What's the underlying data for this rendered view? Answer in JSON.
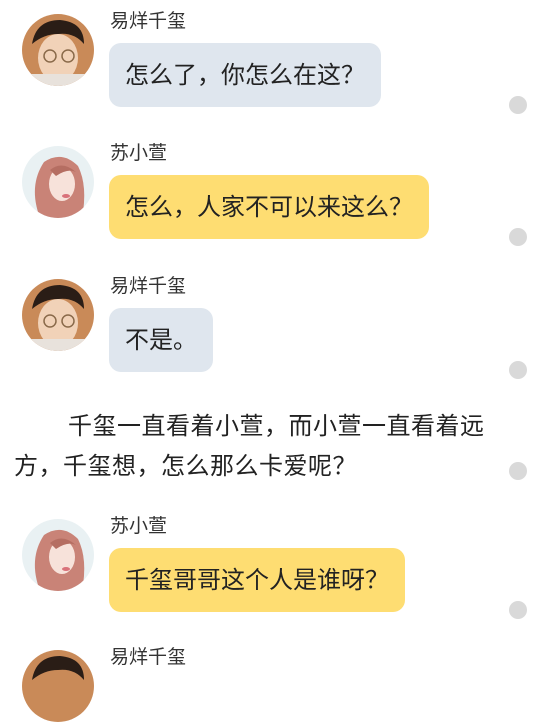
{
  "messages": [
    {
      "speaker": "易烊千玺",
      "avatar": "male-avatar",
      "bubble_color": "#dfe6ee",
      "text": "怎么了，你怎么在这？"
    },
    {
      "speaker": "苏小萱",
      "avatar": "female-avatar",
      "bubble_color": "#fedd72",
      "text": "怎么，人家不可以来这么？"
    },
    {
      "speaker": "易烊千玺",
      "avatar": "male-avatar",
      "bubble_color": "#dfe6ee",
      "text": "不是。"
    },
    {
      "speaker": "苏小萱",
      "avatar": "female-avatar",
      "bubble_color": "#fedd72",
      "text": "千玺哥哥这个人是谁呀？"
    },
    {
      "speaker": "易烊千玺",
      "avatar": "male-avatar"
    }
  ],
  "narration": "千玺一直看着小萱，而小萱一直看着远方，千玺想，怎么那么卡爱呢？",
  "colors": {
    "blue_bubble": "#dfe6ee",
    "yellow_bubble": "#fedd72",
    "indicator_dot": "#d9d9d9"
  }
}
